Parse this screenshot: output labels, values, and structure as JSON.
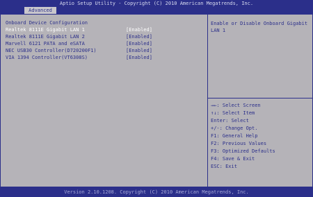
{
  "header": {
    "title": "Aptio Setup Utility - Copyright (C) 2010 American Megatrends, Inc.",
    "tab": "Advanced"
  },
  "section": {
    "title": "Onboard Device Configuration"
  },
  "settings": [
    {
      "label": "Realtek 8111E Gigabit LAN 1",
      "value": "[Enabled]",
      "selected": true
    },
    {
      "label": "Realtek 8111E Gigabit LAN 2",
      "value": "[Enabled]",
      "selected": false
    },
    {
      "label": "Marvell 6121 PATA and eSATA",
      "value": "[Enabled]",
      "selected": false
    },
    {
      "label": "NEC USB30 Controller(D720200F1)",
      "value": "[Enabled]",
      "selected": false
    },
    {
      "label": "VIA 1394 Controller(VT6308S)",
      "value": "[Enabled]",
      "selected": false
    }
  ],
  "help": {
    "text": "Enable or Disable Onboard Gigabit LAN 1"
  },
  "keys": [
    "→←: Select Screen",
    "↑↓: Select Item",
    "Enter: Select",
    "+/-: Change Opt.",
    "F1: General Help",
    "F2: Previous Values",
    "F3: Optimized Defaults",
    "F4: Save & Exit",
    "ESC: Exit"
  ],
  "footer": {
    "text": "Version 2.10.1208. Copyright (C) 2010 American Megatrends, Inc."
  },
  "colors": {
    "header_bg": "#2b2f8a",
    "body_bg": "#b5b3b8",
    "text": "#2b2f8a",
    "selected_text": "#ffffff"
  }
}
